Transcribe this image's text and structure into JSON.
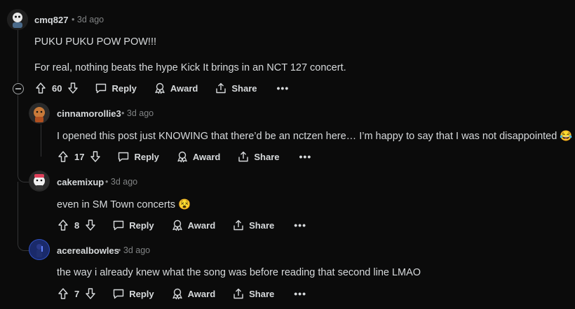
{
  "comments": [
    {
      "username": "cmq827",
      "time": "3d ago",
      "paragraphs": [
        "PUKU PUKU POW POW!!!",
        "For real, nothing beats the hype Kick It brings in an NCT 127 concert."
      ],
      "votes": "60"
    },
    {
      "username": "cinnamorollie3",
      "time": "3d ago",
      "paragraphs": [
        "I opened this post just KNOWING that there’d be an nctzen here… I’m happy to say that I was not disappointed 😂"
      ],
      "votes": "17"
    },
    {
      "username": "cakemixup",
      "time": "3d ago",
      "paragraphs": [
        "even in SM Town concerts 😵"
      ],
      "votes": "8"
    },
    {
      "username": "acerealbowles",
      "time": "3d ago",
      "paragraphs": [
        "the way i already knew what the song was before reading that second line LMAO"
      ],
      "votes": "7"
    }
  ],
  "actions": {
    "reply": "Reply",
    "award": "Award",
    "share": "Share",
    "more": "•••",
    "dot": "•"
  },
  "icons": [
    "collapse-icon",
    "upvote-icon",
    "downvote-icon",
    "comment-icon",
    "award-icon",
    "share-icon",
    "more-icon"
  ]
}
